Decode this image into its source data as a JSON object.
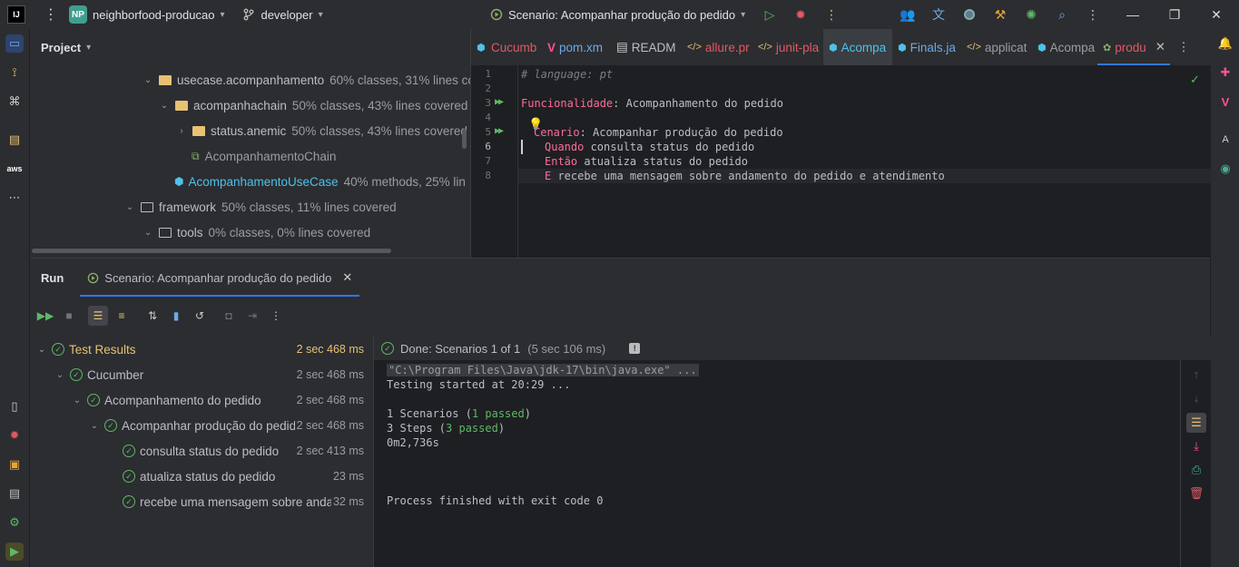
{
  "titlebar": {
    "logo": "IJ",
    "project_initials": "NP",
    "project_name": "neighborfood-producao",
    "branch": "developer",
    "run_config": "Scenario: Acompanhar produção do pedido"
  },
  "project_panel": {
    "title": "Project",
    "rows": [
      {
        "name": "usecase.acompanhamento",
        "coverage": "60% classes, 31% lines co"
      },
      {
        "name": "acompanhachain",
        "coverage": "50% classes, 43% lines covered"
      },
      {
        "name": "status.anemic",
        "coverage": "50% classes, 43% lines covered"
      },
      {
        "name": "AcompanhamentoChain",
        "coverage": ""
      },
      {
        "name": "AcompanhamentoUseCase",
        "coverage": "40% methods, 25% lin"
      },
      {
        "name": "framework",
        "coverage": "50% classes, 11% lines covered"
      },
      {
        "name": "tools",
        "coverage": "0% classes, 0% lines covered"
      }
    ]
  },
  "editor": {
    "tabs": [
      {
        "label": "Cucumb"
      },
      {
        "label": "pom.xm"
      },
      {
        "label": "READM"
      },
      {
        "label": "allure.pr"
      },
      {
        "label": "junit-pla"
      },
      {
        "label": "Acompa"
      },
      {
        "label": "Finals.ja"
      },
      {
        "label": "applicat"
      },
      {
        "label": "Acompa"
      },
      {
        "label": "produ"
      }
    ],
    "lines": {
      "n1": "1",
      "n2": "2",
      "n3": "3",
      "n4": "4",
      "n5": "5",
      "n6": "6",
      "n7": "7",
      "n8": "8",
      "l1": "# language: pt",
      "l3_kw": "Funcionalidade",
      "l3_txt": ": Acompanhamento do pedido",
      "l5_kw": "Cenario",
      "l5_txt": ": Acompanhar produção do pedido",
      "l6_kw": "Quando",
      "l6_txt": " consulta status do pedido",
      "l7_kw": "Então",
      "l7_txt": " atualiza status do pedido",
      "l8_kw": "E",
      "l8_txt": " recebe uma mensagem sobre andamento do pedido e atendimento"
    }
  },
  "run_panel": {
    "title": "Run",
    "tab_label": "Scenario: Acompanhar produção do pedido",
    "tests": [
      {
        "label": "Test Results",
        "time": "2 sec 468 ms"
      },
      {
        "label": "Cucumber",
        "time": "2 sec 468 ms"
      },
      {
        "label": "Acompanhamento do pedido",
        "time": "2 sec 468 ms"
      },
      {
        "label": "Acompanhar produção do pedido",
        "time": "2 sec 468 ms"
      },
      {
        "label": "consulta status do pedido",
        "time": "2 sec 413 ms"
      },
      {
        "label": "atualiza status do pedido",
        "time": "23 ms"
      },
      {
        "label": "recebe uma mensagem sobre andamento do pedido e atendimento",
        "time": "32 ms"
      }
    ],
    "console": {
      "status": "Done: Scenarios 1 of 1",
      "status_time": "(5 sec 106 ms)",
      "cmd": "\"C:\\Program Files\\Java\\jdk-17\\bin\\java.exe\" ...",
      "started": "Testing started at 20:29 ...",
      "scenarios_a": "1 Scenarios (",
      "scenarios_b": "1 passed",
      "scenarios_c": ")",
      "steps_a": "3 Steps (",
      "steps_b": "3 passed",
      "steps_c": ")",
      "duration": "0m2,736s",
      "finished": "Process finished with exit code 0"
    }
  },
  "colors": {
    "accent": "#3574f0",
    "pass": "#5fb865",
    "keyword": "#ff6b9e",
    "folder": "#e8c172"
  }
}
